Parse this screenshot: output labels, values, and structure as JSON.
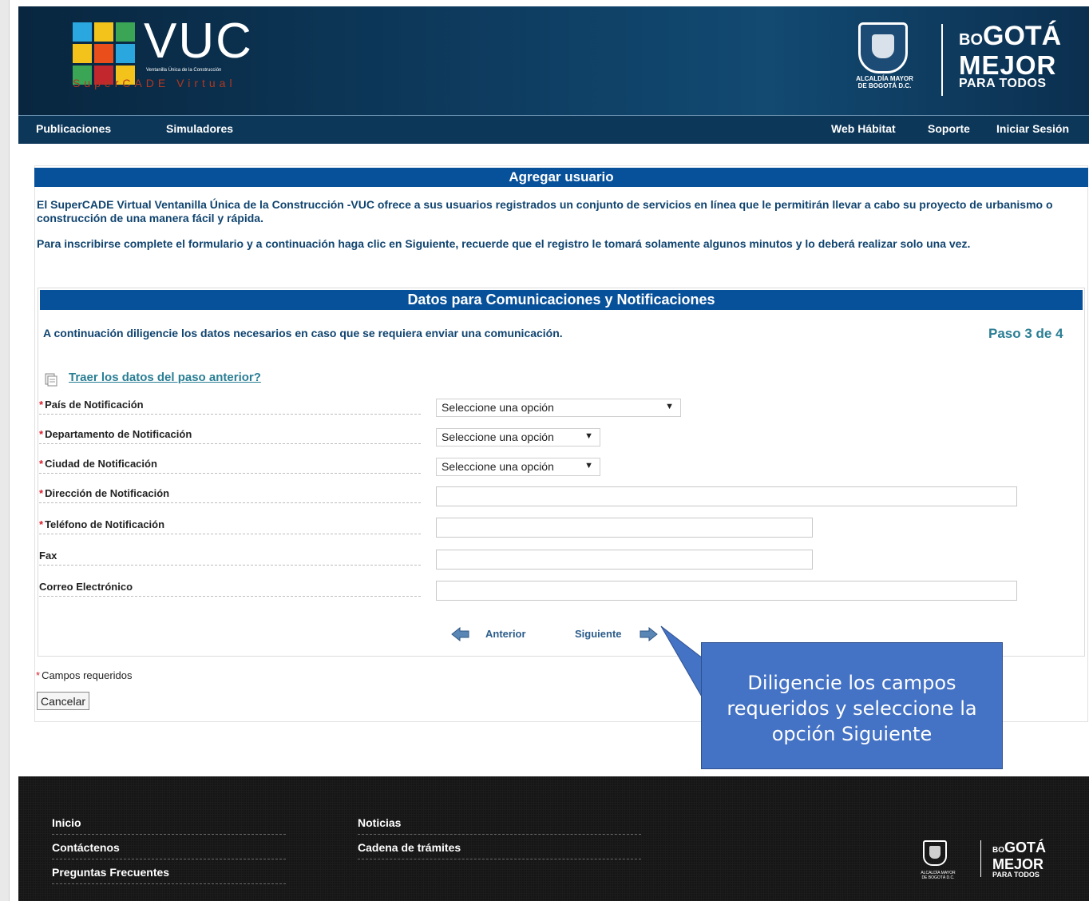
{
  "header": {
    "logo_title": "VUC",
    "logo_subtitle": "Ventanilla Única de la Construcción",
    "logo_tagline": "SuperCADE Virtual",
    "alcaldia_line1": "ALCALDÍA MAYOR",
    "alcaldia_line2": "DE BOGOTÁ D.C.",
    "bogota_small": "BO",
    "bogota_big": "GOTÁ",
    "bogota_line2": "MEJOR",
    "bogota_line3": "PARA TODOS"
  },
  "nav": {
    "left": [
      "Publicaciones",
      "Simuladores"
    ],
    "right": [
      "Web Hábitat",
      "Soporte",
      "Iniciar Sesión"
    ]
  },
  "page": {
    "title": "Agregar usuario",
    "intro1": "El SuperCADE Virtual Ventanilla Única de la Construcción -VUC ofrece a sus usuarios registrados un conjunto de servicios en línea que le permitirán llevar a cabo su proyecto de urbanismo o construcción de una manera fácil y rápida.",
    "intro2": "Para inscribirse complete el formulario y a continuación haga clic en Siguiente, recuerde que el registro le tomará solamente algunos minutos y lo deberá realizar solo una vez."
  },
  "form": {
    "section_title": "Datos para Comunicaciones y Notificaciones",
    "instruction": "A continuación diligencie los datos necesarios en caso que se requiera enviar una comunicación.",
    "step": "Paso 3 de 4",
    "bring_previous": "Traer los datos del paso anterior?",
    "required_mark": "*",
    "fields": {
      "pais": {
        "label": "País de Notificación",
        "value": "Seleccione una opción"
      },
      "departamento": {
        "label": "Departamento de Notificación",
        "value": "Seleccione una opción"
      },
      "ciudad": {
        "label": "Ciudad de Notificación",
        "value": "Seleccione una opción"
      },
      "direccion": {
        "label": "Dirección de Notificación",
        "value": ""
      },
      "telefono": {
        "label": "Teléfono de Notificación",
        "value": ""
      },
      "fax": {
        "label": "Fax",
        "value": ""
      },
      "correo": {
        "label": "Correo Electrónico",
        "value": ""
      }
    },
    "prev_label": "Anterior",
    "next_label": "Siguiente",
    "required_note": "Campos requeridos",
    "cancel_label": "Cancelar"
  },
  "callout": {
    "text": "Diligencie los campos requeridos y seleccione la opción Siguiente"
  },
  "footer": {
    "col1": [
      "Inicio",
      "Contáctenos",
      "Preguntas Frecuentes"
    ],
    "col2": [
      "Noticias",
      "Cadena de trámites"
    ]
  },
  "colors": {
    "header_bg": "#0e3c60",
    "bar_blue": "#07509a",
    "text_blue": "#10446f",
    "callout_blue": "#4472c4",
    "required_red": "#d9202f"
  }
}
